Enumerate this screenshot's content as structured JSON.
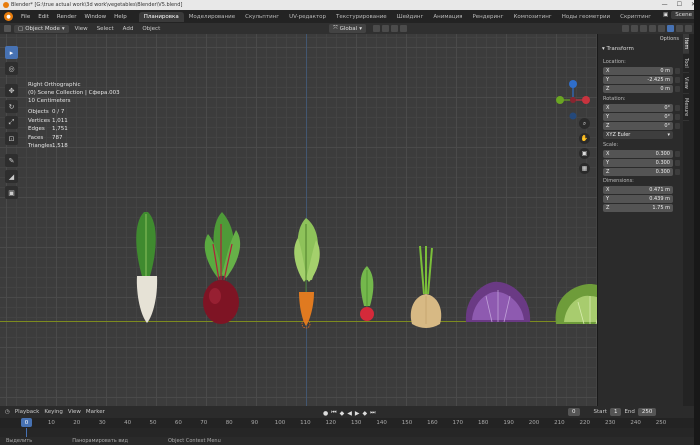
{
  "window": {
    "title": "Blender* [G:\\true actual work\\3d work\\vegetables\\Blender\\V5.blend]"
  },
  "menu": [
    "File",
    "Edit",
    "Render",
    "Window",
    "Help"
  ],
  "workspaces": [
    "Планировка",
    "Моделирование",
    "Скульптинг",
    "UV-редактор",
    "Текстурирование",
    "Шейдинг",
    "Анимация",
    "Рендеринг",
    "Композитинг",
    "Ноды геометрии",
    "Скриптинг"
  ],
  "active_workspace": "Планировка",
  "scene": {
    "name": "Scene"
  },
  "header": {
    "mode": "Object Mode",
    "menus": [
      "View",
      "Select",
      "Add",
      "Object"
    ],
    "orientation": "Global"
  },
  "viewport": {
    "view_name": "Right Orthographic",
    "collection": "(0) Scene Collection | Сфера.003",
    "scale": "10 Centimeters",
    "stats": [
      {
        "k": "Objects",
        "v": "0 / 7"
      },
      {
        "k": "Vertices",
        "v": "1,011"
      },
      {
        "k": "Edges",
        "v": "1,751"
      },
      {
        "k": "Faces",
        "v": "787"
      },
      {
        "k": "Triangles",
        "v": "1,518"
      }
    ]
  },
  "npanel": {
    "options_label": "Options",
    "section": "Transform",
    "location_label": "Location:",
    "location": [
      {
        "axis": "X",
        "value": "0 m"
      },
      {
        "axis": "Y",
        "value": "-2.425 m"
      },
      {
        "axis": "Z",
        "value": "0 m"
      }
    ],
    "rotation_label": "Rotation:",
    "rotation": [
      {
        "axis": "X",
        "value": "0°"
      },
      {
        "axis": "Y",
        "value": "0°"
      },
      {
        "axis": "Z",
        "value": "0°"
      }
    ],
    "rotation_mode": "XYZ Euler",
    "scale_label": "Scale:",
    "scale": [
      {
        "axis": "X",
        "value": "0.300"
      },
      {
        "axis": "Y",
        "value": "0.300"
      },
      {
        "axis": "Z",
        "value": "0.300"
      }
    ],
    "dimensions_label": "Dimensions:",
    "dimensions": [
      {
        "axis": "X",
        "value": "0.471 m"
      },
      {
        "axis": "Y",
        "value": "0.439 m"
      },
      {
        "axis": "Z",
        "value": "1.75 m"
      }
    ],
    "tabs": [
      "Item",
      "Tool",
      "View",
      "Mesure"
    ]
  },
  "timeline": {
    "menus": [
      "Playback",
      "Keying",
      "View",
      "Marker"
    ],
    "current_frame": "0",
    "start_label": "Start",
    "start": "1",
    "end_label": "End",
    "end": "250",
    "ruler": [
      "0",
      "10",
      "20",
      "30",
      "40",
      "50",
      "60",
      "70",
      "80",
      "90",
      "100",
      "110",
      "120",
      "130",
      "140",
      "150",
      "160",
      "170",
      "180",
      "190",
      "200",
      "210",
      "220",
      "230",
      "240",
      "250"
    ],
    "cursor": "0"
  },
  "status": [
    "Выделить",
    "Панорамировать вид",
    "Object Context Menu"
  ],
  "colors": {
    "accent": "#4772b3",
    "horizon": "#7d8b1f",
    "logo": "#e87d0d"
  }
}
